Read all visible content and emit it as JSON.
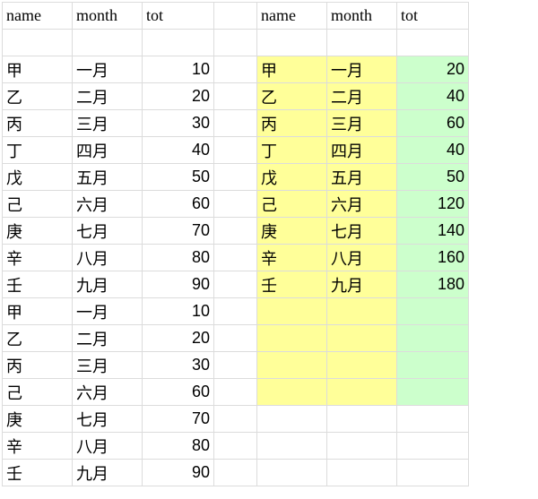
{
  "headers": {
    "name": "name",
    "month": "month",
    "tot": "tot"
  },
  "left": [
    {
      "name": "甲",
      "month": "一月",
      "tot": 10
    },
    {
      "name": "乙",
      "month": "二月",
      "tot": 20
    },
    {
      "name": "丙",
      "month": "三月",
      "tot": 30
    },
    {
      "name": "丁",
      "month": "四月",
      "tot": 40
    },
    {
      "name": "戊",
      "month": "五月",
      "tot": 50
    },
    {
      "name": "己",
      "month": "六月",
      "tot": 60
    },
    {
      "name": "庚",
      "month": "七月",
      "tot": 70
    },
    {
      "name": "辛",
      "month": "八月",
      "tot": 80
    },
    {
      "name": "壬",
      "month": "九月",
      "tot": 90
    },
    {
      "name": "甲",
      "month": "一月",
      "tot": 10
    },
    {
      "name": "乙",
      "month": "二月",
      "tot": 20
    },
    {
      "name": "丙",
      "month": "三月",
      "tot": 30
    },
    {
      "name": "己",
      "month": "六月",
      "tot": 60
    },
    {
      "name": "庚",
      "month": "七月",
      "tot": 70
    },
    {
      "name": "辛",
      "month": "八月",
      "tot": 80
    },
    {
      "name": "壬",
      "month": "九月",
      "tot": 90
    }
  ],
  "right": [
    {
      "name": "甲",
      "month": "一月",
      "tot": 20
    },
    {
      "name": "乙",
      "month": "二月",
      "tot": 40
    },
    {
      "name": "丙",
      "month": "三月",
      "tot": 60
    },
    {
      "name": "丁",
      "month": "四月",
      "tot": 40
    },
    {
      "name": "戊",
      "month": "五月",
      "tot": 50
    },
    {
      "name": "己",
      "month": "六月",
      "tot": 120
    },
    {
      "name": "庚",
      "month": "七月",
      "tot": 140
    },
    {
      "name": "辛",
      "month": "八月",
      "tot": 160
    },
    {
      "name": "壬",
      "month": "九月",
      "tot": 180
    }
  ],
  "right_pad_rows": 4
}
